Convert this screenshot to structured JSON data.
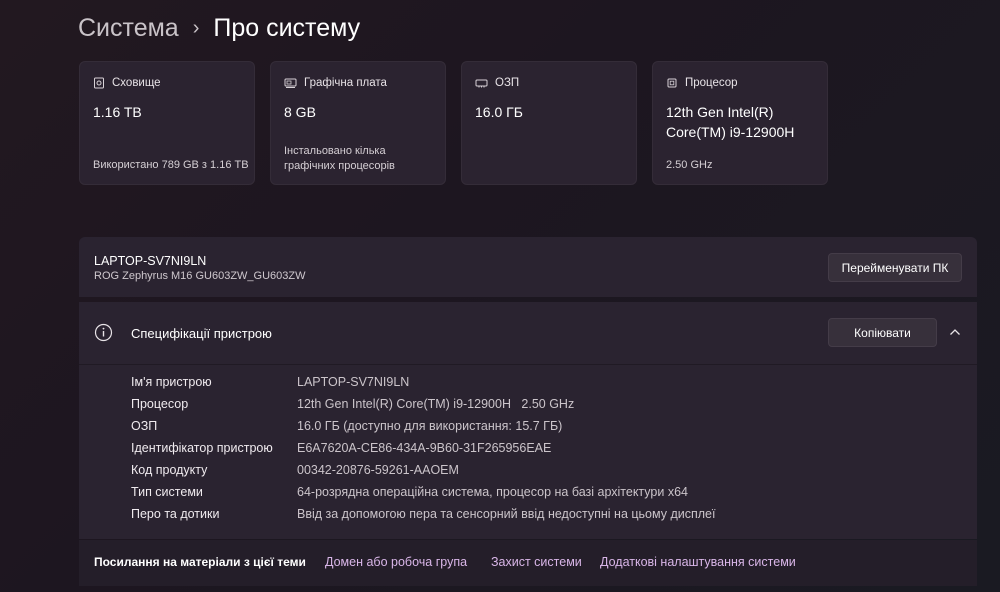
{
  "breadcrumb": {
    "parent": "Система",
    "separator": "›",
    "current": "Про систему"
  },
  "cards": [
    {
      "icon": "storage-icon",
      "title": "Сховище",
      "value": "1.16 TB",
      "sub": "Використано 789 GB з 1.16 TB"
    },
    {
      "icon": "graphics-card-icon",
      "title": "Графічна плата",
      "value": "8 GB",
      "sub": "Інстальовано кілька графічних процесорів"
    },
    {
      "icon": "ram-icon",
      "title": "ОЗП",
      "value": "16.0 ГБ",
      "sub": ""
    },
    {
      "icon": "processor-icon",
      "title": "Процесор",
      "value": "12th Gen Intel(R) Core(TM) i9-12900H",
      "sub": "2.50 GHz"
    }
  ],
  "device": {
    "name": "LAPTOP-SV7NI9LN",
    "model": "ROG Zephyrus M16 GU603ZW_GU603ZW",
    "rename_label": "Перейменувати ПК"
  },
  "specs": {
    "title": "Специфікації пристрою",
    "copy_label": "Копіювати",
    "rows": [
      {
        "key": "Ім'я пристрою",
        "value": "LAPTOP-SV7NI9LN"
      },
      {
        "key": "Процесор",
        "value": "12th Gen Intel(R) Core(TM) i9-12900H   2.50 GHz"
      },
      {
        "key": "ОЗП",
        "value": "16.0 ГБ (доступно для використання: 15.7 ГБ)"
      },
      {
        "key": "Ідентифікатор пристрою",
        "value": "E6A7620A-CE86-434A-9B60-31F265956EAE"
      },
      {
        "key": "Код продукту",
        "value": "00342-20876-59261-AAOEM"
      },
      {
        "key": "Тип системи",
        "value": "64-розрядна операційна система, процесор на базі архітектури x64"
      },
      {
        "key": "Перо та дотики",
        "value": "Ввід за допомогою пера та сенсорний ввід недоступні на цьому дисплеї"
      }
    ]
  },
  "related": {
    "label": "Посилання на матеріали з цієї теми",
    "links": [
      "Домен або робоча група",
      "Захист системи",
      "Додаткові налаштування системи"
    ]
  },
  "colors": {
    "link": "#d9b6e8",
    "card_bg": "#2b2330",
    "panel_bg": "#2a2330"
  }
}
